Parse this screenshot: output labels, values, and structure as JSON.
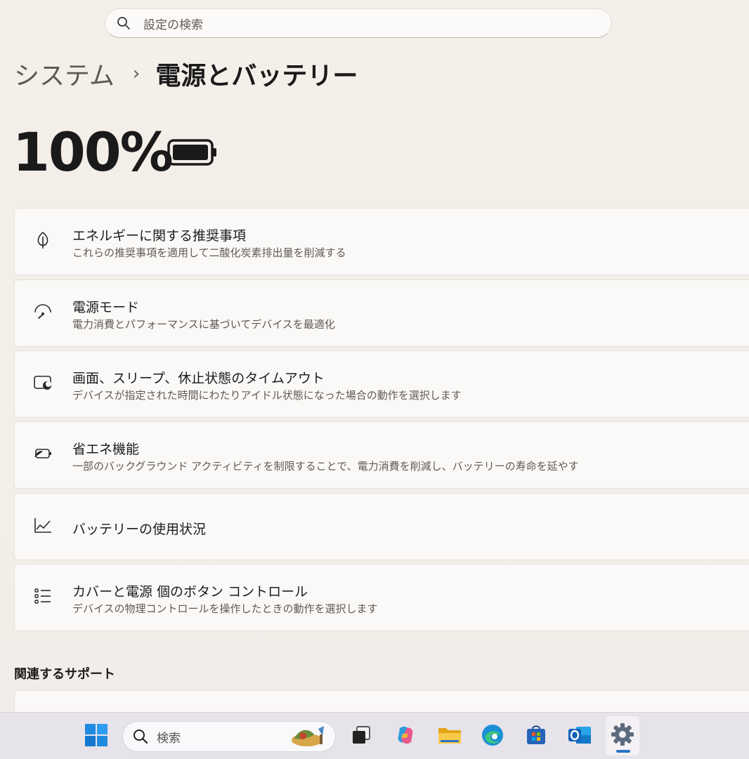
{
  "search": {
    "placeholder": "設定の検索"
  },
  "breadcrumb": {
    "parent": "システム",
    "separator": "›",
    "current": "電源とバッテリー"
  },
  "battery": {
    "level_text": "100%",
    "level_fraction": 1.0
  },
  "cards": [
    {
      "icon": "leaf-icon",
      "title": "エネルギーに関する推奨事項",
      "description": "これらの推奨事項を適用して二酸化炭素排出量を削減する"
    },
    {
      "icon": "power-mode-gauge-icon",
      "title": "電源モード",
      "description": "電力消費とパフォーマンスに基づいてデバイスを最適化"
    },
    {
      "icon": "screen-sleep-icon",
      "title": "画面、スリープ、休止状態のタイムアウト",
      "description": "デバイスが指定された時間にわたりアイドル状態になった場合の動作を選択します"
    },
    {
      "icon": "energy-saver-icon",
      "title": "省エネ機能",
      "description": "一部のバックグラウンド アクティビティを制限することで、電力消費を削減し、バッテリーの寿命を延やす"
    },
    {
      "icon": "battery-usage-chart-icon",
      "title": "バッテリーの使用状況",
      "description": ""
    },
    {
      "icon": "list-controls-icon",
      "title": "カバーと電源 個のボタン コントロール",
      "description": "デバイスの物理コントロールを操作したときの動作を選択します"
    }
  ],
  "related": {
    "title": "関連するサポート"
  },
  "taskbar": {
    "search_label": "検索",
    "items": [
      {
        "icon": "windows-start-icon"
      },
      {
        "icon": "task-view-icon"
      },
      {
        "icon": "copilot-icon"
      },
      {
        "icon": "file-explorer-icon"
      },
      {
        "icon": "edge-icon"
      },
      {
        "icon": "store-icon"
      },
      {
        "icon": "outlook-icon"
      },
      {
        "icon": "settings-gear-icon"
      }
    ],
    "colors": {
      "accent": "#2b73c2",
      "folder": "#f0b429",
      "edge": "#1a8fd8",
      "outlook": "#0f63b8"
    }
  }
}
